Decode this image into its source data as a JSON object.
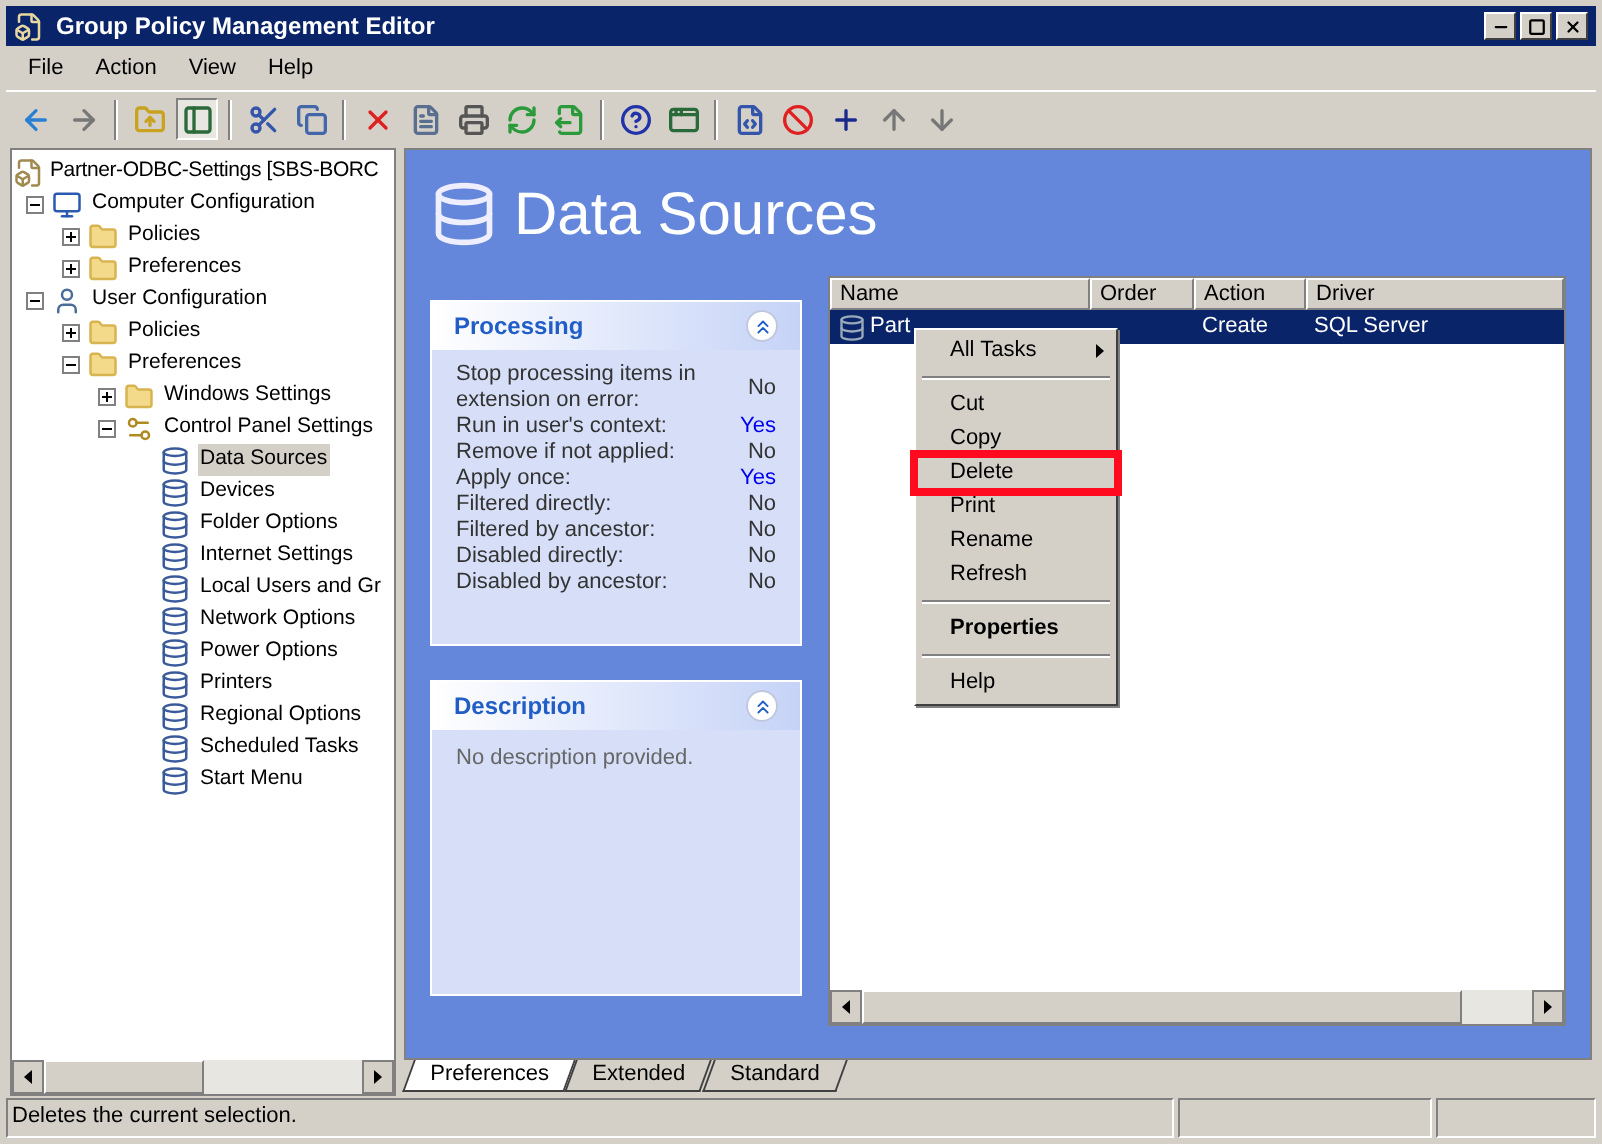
{
  "window": {
    "title": "Group Policy Management Editor"
  },
  "menu": [
    "File",
    "Action",
    "View",
    "Help"
  ],
  "toolbar": [
    {
      "kind": "back",
      "pressed": false
    },
    {
      "kind": "forward",
      "pressed": false
    },
    {
      "kind": "separator"
    },
    {
      "kind": "up",
      "pressed": false
    },
    {
      "kind": "tree",
      "pressed": true
    },
    {
      "kind": "separator"
    },
    {
      "kind": "cut",
      "pressed": false
    },
    {
      "kind": "copy",
      "pressed": false
    },
    {
      "kind": "separator"
    },
    {
      "kind": "delete",
      "pressed": false
    },
    {
      "kind": "properties",
      "pressed": false
    },
    {
      "kind": "print",
      "pressed": false
    },
    {
      "kind": "refresh",
      "pressed": false
    },
    {
      "kind": "export",
      "pressed": false
    },
    {
      "kind": "separator"
    },
    {
      "kind": "help",
      "pressed": false
    },
    {
      "kind": "view",
      "pressed": false
    },
    {
      "kind": "separator"
    },
    {
      "kind": "xml",
      "pressed": false
    },
    {
      "kind": "stop",
      "pressed": false
    },
    {
      "kind": "add",
      "pressed": false
    },
    {
      "kind": "move-up",
      "pressed": false
    },
    {
      "kind": "move-down",
      "pressed": false
    }
  ],
  "tree": [
    {
      "label": "Partner-ODBC-Settings [SBS-BORC",
      "kind": "root",
      "selected": false,
      "children": [
        {
          "label": "Computer Configuration",
          "kind": "computer",
          "expanded": true,
          "selected": false,
          "children": [
            {
              "label": "Policies",
              "kind": "folder",
              "expanded": false,
              "selected": false
            },
            {
              "label": "Preferences",
              "kind": "folder",
              "expanded": false,
              "selected": false
            }
          ]
        },
        {
          "label": "User Configuration",
          "kind": "user",
          "expanded": true,
          "selected": false,
          "children": [
            {
              "label": "Policies",
              "kind": "folder",
              "expanded": false,
              "selected": false
            },
            {
              "label": "Preferences",
              "kind": "folder",
              "expanded": true,
              "selected": false,
              "children": [
                {
                  "label": "Windows Settings",
                  "kind": "folder",
                  "expanded": false,
                  "selected": false
                },
                {
                  "label": "Control Panel Settings",
                  "kind": "panel",
                  "expanded": true,
                  "selected": false,
                  "children": [
                    {
                      "label": "Data Sources",
                      "kind": "item",
                      "selected": true
                    },
                    {
                      "label": "Devices",
                      "kind": "item",
                      "selected": false
                    },
                    {
                      "label": "Folder Options",
                      "kind": "item",
                      "selected": false
                    },
                    {
                      "label": "Internet Settings",
                      "kind": "item",
                      "selected": false
                    },
                    {
                      "label": "Local Users and Gr",
                      "kind": "item",
                      "selected": false
                    },
                    {
                      "label": "Network Options",
                      "kind": "item",
                      "selected": false
                    },
                    {
                      "label": "Power Options",
                      "kind": "item",
                      "selected": false
                    },
                    {
                      "label": "Printers",
                      "kind": "item",
                      "selected": false
                    },
                    {
                      "label": "Regional Options",
                      "kind": "item",
                      "selected": false
                    },
                    {
                      "label": "Scheduled Tasks",
                      "kind": "item",
                      "selected": false
                    },
                    {
                      "label": "Start Menu",
                      "kind": "item",
                      "selected": false
                    }
                  ]
                }
              ]
            }
          ]
        }
      ]
    }
  ],
  "heading": "Data Sources",
  "processing": {
    "title": "Processing",
    "rows": [
      {
        "label": "Stop processing items in extension on error:",
        "value": "No",
        "emphasis": false
      },
      {
        "label": "Run in user's context:",
        "value": "Yes",
        "emphasis": true
      },
      {
        "label": "Remove if not applied:",
        "value": "No",
        "emphasis": false
      },
      {
        "label": "Apply once:",
        "value": "Yes",
        "emphasis": true
      },
      {
        "label": "Filtered directly:",
        "value": "No",
        "emphasis": false
      },
      {
        "label": "Filtered by ancestor:",
        "value": "No",
        "emphasis": false
      },
      {
        "label": "Disabled directly:",
        "value": "No",
        "emphasis": false
      },
      {
        "label": "Disabled by ancestor:",
        "value": "No",
        "emphasis": false
      }
    ]
  },
  "description": {
    "title": "Description",
    "text": "No description provided."
  },
  "table": {
    "columns": [
      "Name",
      "Order",
      "Action",
      "Driver"
    ],
    "rows": [
      {
        "name": "Part",
        "action": "Create",
        "driver": "SQL Server",
        "selected": true
      }
    ]
  },
  "context_menu": [
    {
      "label": "All Tasks",
      "kind": "submenu",
      "highlighted": false
    },
    {
      "kind": "separator"
    },
    {
      "label": "Cut",
      "kind": "item",
      "highlighted": false
    },
    {
      "label": "Copy",
      "kind": "item",
      "highlighted": false
    },
    {
      "label": "Delete",
      "kind": "item",
      "highlighted": true
    },
    {
      "label": "Print",
      "kind": "item",
      "highlighted": false
    },
    {
      "label": "Rename",
      "kind": "item",
      "highlighted": false
    },
    {
      "label": "Refresh",
      "kind": "item",
      "highlighted": false
    },
    {
      "kind": "separator"
    },
    {
      "label": "Properties",
      "kind": "default",
      "highlighted": false
    },
    {
      "kind": "separator"
    },
    {
      "label": "Help",
      "kind": "item",
      "highlighted": false
    }
  ],
  "tabs": [
    {
      "label": "Preferences",
      "selected": true
    },
    {
      "label": "Extended",
      "selected": false
    },
    {
      "label": "Standard",
      "selected": false
    }
  ],
  "status_bar": {
    "text": "Deletes the current selection."
  }
}
